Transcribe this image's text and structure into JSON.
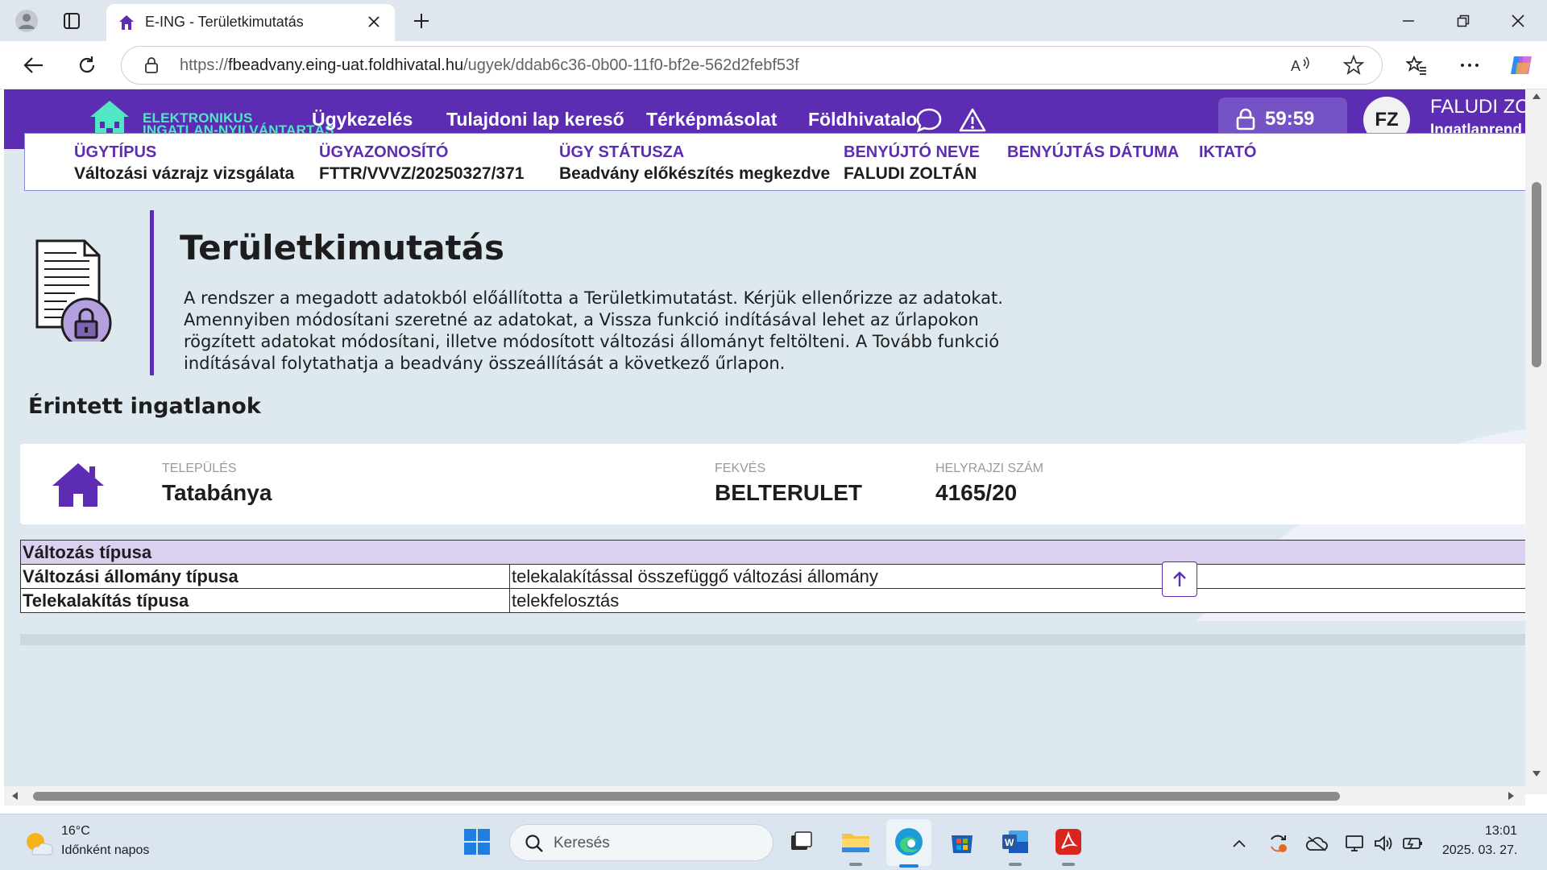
{
  "browser": {
    "tab_title": "E-ING - Területkimutatás",
    "url_prefix": "https://",
    "url_host": "fbeadvany.eing-uat.foldhivatal.hu",
    "url_path": "/ugyek/ddab6c36-0b00-11f0-bf2e-562d2febf53f"
  },
  "site": {
    "logo_line1": "ELEKTRONIKUS",
    "logo_line2": "INGATLAN-NYILVÁNTARTÁS",
    "nav": [
      "Ügykezelés",
      "Tulajdoni lap kereső",
      "Térképmásolat",
      "Földhivatalo"
    ],
    "timer": "59:59",
    "avatar_initials": "FZ",
    "user_name": "FALUDI ZO",
    "user_role": "Ingatlanrend",
    "brand_color": "#5c2db3",
    "accent_color": "#53e6c4"
  },
  "case": {
    "labels": [
      "ÜGYTÍPUS",
      "ÜGYAZONOSÍTÓ",
      "ÜGY STÁTUSZA",
      "BENYÚJTÓ NEVE",
      "BENYÚJTÁS DÁTUMA",
      "IKTATÓ"
    ],
    "values": [
      "Változási vázrajz vizsgálata",
      "FTTR/VVVZ/20250327/371",
      "Beadvány előkészítés megkezdve",
      "FALUDI ZOLTÁN",
      "",
      ""
    ]
  },
  "main": {
    "title": "Területkimutatás",
    "intro": "A rendszer a megadott adatokból előállította a Területkimutatást. Kérjük ellenőrizze az adatokat. Amennyiben módosítani szeretné az adatokat, a Vissza funkció indításával lehet az űrlapokon rögzített adatokat módosítani, illetve módosított változási állományt feltölteni. A Tovább funkció indításával folytathatja a beadvány összeállítását a következő űrlapon.",
    "section_title": "Érintett ingatlanok"
  },
  "property": {
    "telepules_label": "TELEPÜLÉS",
    "telepules": "Tatabánya",
    "fekves_label": "FEKVÉS",
    "fekves": "BELTERULET",
    "hrsz_label": "HELYRAJZI SZÁM",
    "hrsz": "4165/20"
  },
  "change_table": {
    "header": "Változás típusa",
    "rows": [
      {
        "key": "Változási állomány típusa",
        "value": "telekalakítással összefüggő változási állomány"
      },
      {
        "key": "Telekalakítás típusa",
        "value": "telekfelosztás"
      }
    ]
  },
  "taskbar": {
    "weather_temp": "16°C",
    "weather_desc": "Időnként napos",
    "search_placeholder": "Keresés",
    "time": "13:01",
    "date": "2025. 03. 27."
  }
}
